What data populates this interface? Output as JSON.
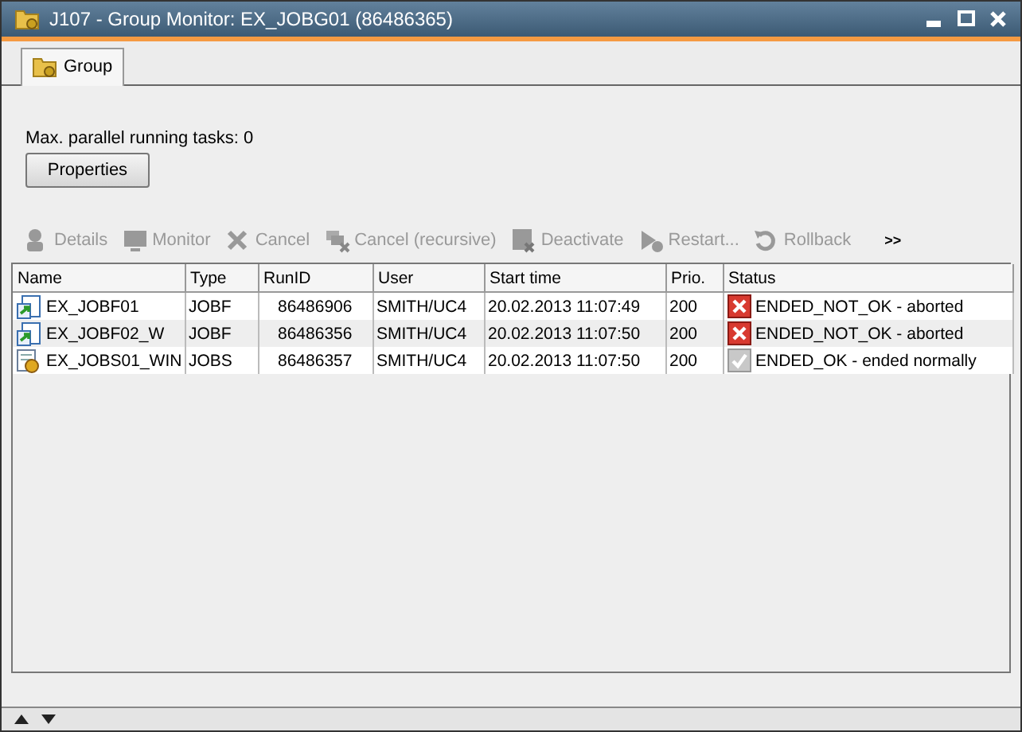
{
  "window": {
    "title": "J107 - Group Monitor: EX_JOBG01 (86486365)"
  },
  "tabs": [
    {
      "label": "Group",
      "selected": true
    }
  ],
  "max_tasks": "Max. parallel running tasks: 0",
  "properties_button": "Properties",
  "toolbar": [
    {
      "label": "Details",
      "kind": "details",
      "disabled": true
    },
    {
      "label": "Monitor",
      "kind": "monitor",
      "disabled": true
    },
    {
      "label": "Cancel",
      "kind": "cancel",
      "disabled": true
    },
    {
      "label": "Cancel (recursive)",
      "kind": "cancel-recursive",
      "disabled": true
    },
    {
      "label": "Deactivate",
      "kind": "deactivate",
      "disabled": true
    },
    {
      "label": "Restart...",
      "kind": "restart",
      "disabled": true
    },
    {
      "label": "Rollback",
      "kind": "rollback",
      "disabled": true
    }
  ],
  "toolbar_more": ">>",
  "table": {
    "columns": [
      "Name",
      "Type",
      "RunID",
      "User",
      "Start time",
      "Prio.",
      "Status"
    ],
    "rows": [
      {
        "kind": "jobf",
        "cells": [
          "EX_JOBF01",
          "JOBF",
          "86486906",
          "SMITH/UC4",
          "20.02.2013 11:07:49",
          "200"
        ],
        "status": {
          "kind": "error",
          "text": "ENDED_NOT_OK - aborted"
        }
      },
      {
        "kind": "jobf",
        "cells": [
          "EX_JOBF02_W",
          "JOBF",
          "86486356",
          "SMITH/UC4",
          "20.02.2013 11:07:50",
          "200"
        ],
        "status": {
          "kind": "error",
          "text": "ENDED_NOT_OK - aborted"
        }
      },
      {
        "kind": "jobs",
        "cells": [
          "EX_JOBS01_WIN",
          "JOBS",
          "86486357",
          "SMITH/UC4",
          "20.02.2013 11:07:50",
          "200"
        ],
        "status": {
          "kind": "ok",
          "text": "ENDED_OK - ended normally"
        }
      }
    ]
  }
}
